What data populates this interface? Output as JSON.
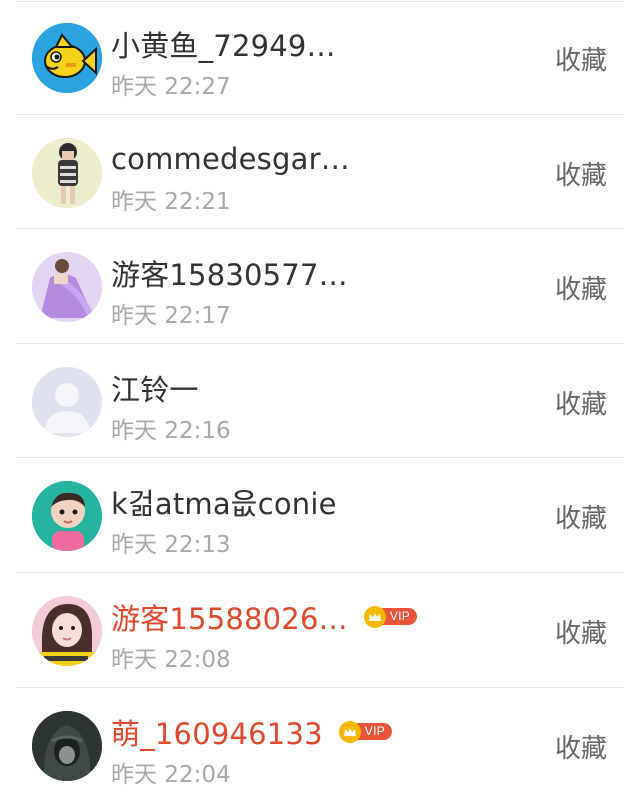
{
  "colors": {
    "name_default": "#333333",
    "name_vip": "#e2482c",
    "time": "#a8a8a8",
    "action": "#666666",
    "divider": "#e6e6e6",
    "vip_badge": "#e8553a",
    "vip_crown": "#f5b800"
  },
  "list": {
    "items": [
      {
        "name": "小黄鱼_72949…",
        "time": "昨天 22:27",
        "action": "收藏",
        "vip": false,
        "avatar": "yellow-fish-avatar"
      },
      {
        "name": "commedesgar…",
        "time": "昨天 22:21",
        "action": "收藏",
        "vip": false,
        "avatar": "girl-photo-avatar"
      },
      {
        "name": "游客15830577…",
        "time": "昨天 22:17",
        "action": "收藏",
        "vip": false,
        "avatar": "purple-dress-avatar"
      },
      {
        "name": "江铃一",
        "time": "昨天 22:16",
        "action": "收藏",
        "vip": false,
        "avatar": "default-person-avatar"
      },
      {
        "name": "k걺atma읎conie",
        "time": "昨天 22:13",
        "action": "收藏",
        "vip": false,
        "avatar": "baby-photo-avatar"
      },
      {
        "name": "游客15588026…",
        "time": "昨天 22:08",
        "action": "收藏",
        "vip": true,
        "vip_label": "VIP",
        "avatar": "pink-girl-avatar"
      },
      {
        "name": "萌_160946133",
        "time": "昨天 22:04",
        "action": "收藏",
        "vip": true,
        "vip_label": "VIP",
        "avatar": "hooded-figure-avatar"
      }
    ]
  }
}
